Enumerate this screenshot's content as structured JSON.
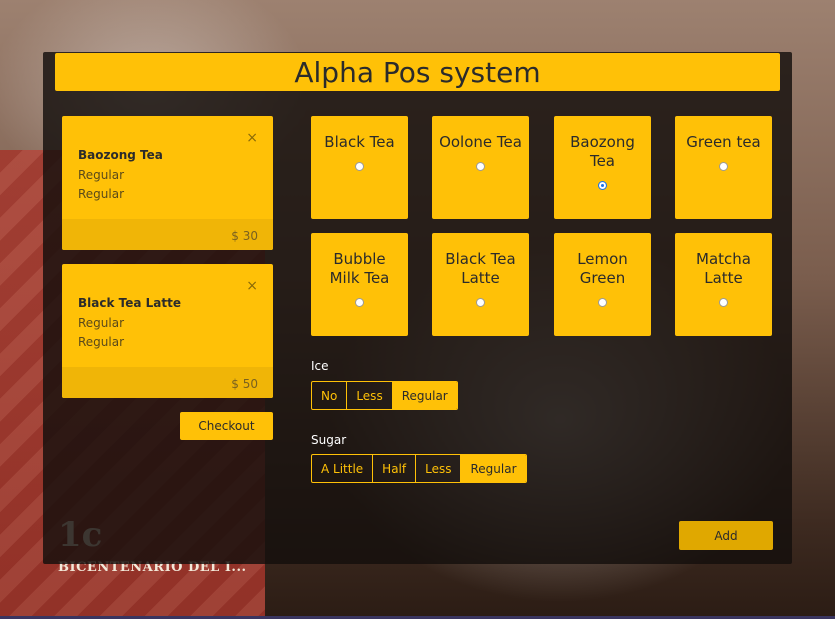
{
  "app": {
    "title": "Alpha Pos system"
  },
  "background": {
    "stamp_number": "1c",
    "stamp_text": "BICENTENARIO DEL I..."
  },
  "orders": [
    {
      "name": "Baozong Tea",
      "ice": "Regular",
      "sugar": "Regular",
      "price": "$ 30",
      "close": "×"
    },
    {
      "name": "Black Tea Latte",
      "ice": "Regular",
      "sugar": "Regular",
      "price": "$ 50",
      "close": "×"
    }
  ],
  "checkout_label": "Checkout",
  "teas": [
    {
      "name": "Black Tea",
      "checked": false
    },
    {
      "name": "Oolone Tea",
      "checked": false
    },
    {
      "name": "Baozong Tea",
      "checked": true
    },
    {
      "name": "Green tea",
      "checked": false
    },
    {
      "name": "Bubble Milk Tea",
      "checked": false
    },
    {
      "name": "Black Tea Latte",
      "checked": false
    },
    {
      "name": "Lemon Green",
      "checked": false
    },
    {
      "name": "Matcha Latte",
      "checked": false
    }
  ],
  "ice": {
    "label": "Ice",
    "options": [
      "No",
      "Less",
      "Regular"
    ],
    "selected": "Regular"
  },
  "sugar": {
    "label": "Sugar",
    "options": [
      "A Little",
      "Half",
      "Less",
      "Regular"
    ],
    "selected": "Regular"
  },
  "add_label": "Add",
  "colors": {
    "accent": "#ffc107",
    "panel": "#140f0c",
    "text_dark": "#2b2b2b"
  }
}
